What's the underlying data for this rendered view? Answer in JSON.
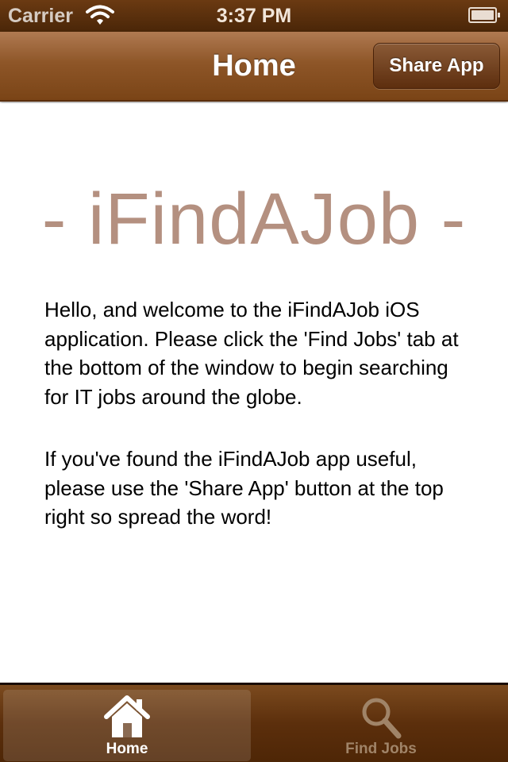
{
  "status_bar": {
    "carrier": "Carrier",
    "time": "3:37 PM",
    "icons": [
      "wifi-icon",
      "battery-icon"
    ]
  },
  "nav_bar": {
    "title": "Home",
    "share_button_label": "Share App"
  },
  "content": {
    "app_title": "- iFindAJob -",
    "paragraph_1": "Hello, and welcome to the iFindAJob iOS application. Please click the 'Find Jobs' tab at the bottom of the window to begin searching for IT jobs around the globe.",
    "paragraph_2": "If you've found the iFindAJob app useful, please use the 'Share App' button at the top right so spread the word!"
  },
  "tab_bar": {
    "tabs": [
      {
        "label": "Home",
        "icon": "house-icon",
        "selected": true
      },
      {
        "label": "Find Jobs",
        "icon": "magnifier-icon",
        "selected": false
      }
    ]
  },
  "colors": {
    "nav_brown": "#8e5628",
    "title_tan": "#b49080",
    "tab_bar_brown": "#5c2f0c"
  }
}
